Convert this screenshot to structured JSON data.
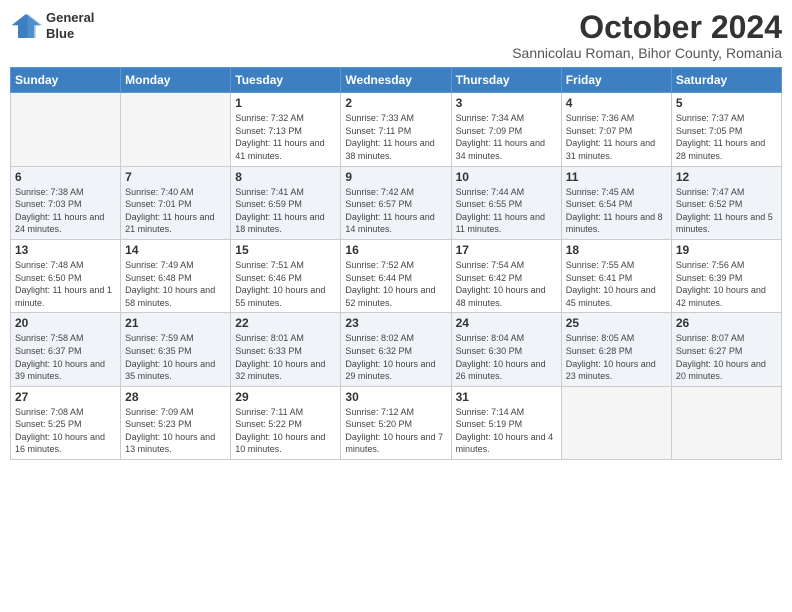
{
  "logo": {
    "line1": "General",
    "line2": "Blue"
  },
  "title": "October 2024",
  "subtitle": "Sannicolau Roman, Bihor County, Romania",
  "weekdays": [
    "Sunday",
    "Monday",
    "Tuesday",
    "Wednesday",
    "Thursday",
    "Friday",
    "Saturday"
  ],
  "weeks": [
    [
      {
        "day": "",
        "info": ""
      },
      {
        "day": "",
        "info": ""
      },
      {
        "day": "1",
        "info": "Sunrise: 7:32 AM\nSunset: 7:13 PM\nDaylight: 11 hours and 41 minutes."
      },
      {
        "day": "2",
        "info": "Sunrise: 7:33 AM\nSunset: 7:11 PM\nDaylight: 11 hours and 38 minutes."
      },
      {
        "day": "3",
        "info": "Sunrise: 7:34 AM\nSunset: 7:09 PM\nDaylight: 11 hours and 34 minutes."
      },
      {
        "day": "4",
        "info": "Sunrise: 7:36 AM\nSunset: 7:07 PM\nDaylight: 11 hours and 31 minutes."
      },
      {
        "day": "5",
        "info": "Sunrise: 7:37 AM\nSunset: 7:05 PM\nDaylight: 11 hours and 28 minutes."
      }
    ],
    [
      {
        "day": "6",
        "info": "Sunrise: 7:38 AM\nSunset: 7:03 PM\nDaylight: 11 hours and 24 minutes."
      },
      {
        "day": "7",
        "info": "Sunrise: 7:40 AM\nSunset: 7:01 PM\nDaylight: 11 hours and 21 minutes."
      },
      {
        "day": "8",
        "info": "Sunrise: 7:41 AM\nSunset: 6:59 PM\nDaylight: 11 hours and 18 minutes."
      },
      {
        "day": "9",
        "info": "Sunrise: 7:42 AM\nSunset: 6:57 PM\nDaylight: 11 hours and 14 minutes."
      },
      {
        "day": "10",
        "info": "Sunrise: 7:44 AM\nSunset: 6:55 PM\nDaylight: 11 hours and 11 minutes."
      },
      {
        "day": "11",
        "info": "Sunrise: 7:45 AM\nSunset: 6:54 PM\nDaylight: 11 hours and 8 minutes."
      },
      {
        "day": "12",
        "info": "Sunrise: 7:47 AM\nSunset: 6:52 PM\nDaylight: 11 hours and 5 minutes."
      }
    ],
    [
      {
        "day": "13",
        "info": "Sunrise: 7:48 AM\nSunset: 6:50 PM\nDaylight: 11 hours and 1 minute."
      },
      {
        "day": "14",
        "info": "Sunrise: 7:49 AM\nSunset: 6:48 PM\nDaylight: 10 hours and 58 minutes."
      },
      {
        "day": "15",
        "info": "Sunrise: 7:51 AM\nSunset: 6:46 PM\nDaylight: 10 hours and 55 minutes."
      },
      {
        "day": "16",
        "info": "Sunrise: 7:52 AM\nSunset: 6:44 PM\nDaylight: 10 hours and 52 minutes."
      },
      {
        "day": "17",
        "info": "Sunrise: 7:54 AM\nSunset: 6:42 PM\nDaylight: 10 hours and 48 minutes."
      },
      {
        "day": "18",
        "info": "Sunrise: 7:55 AM\nSunset: 6:41 PM\nDaylight: 10 hours and 45 minutes."
      },
      {
        "day": "19",
        "info": "Sunrise: 7:56 AM\nSunset: 6:39 PM\nDaylight: 10 hours and 42 minutes."
      }
    ],
    [
      {
        "day": "20",
        "info": "Sunrise: 7:58 AM\nSunset: 6:37 PM\nDaylight: 10 hours and 39 minutes."
      },
      {
        "day": "21",
        "info": "Sunrise: 7:59 AM\nSunset: 6:35 PM\nDaylight: 10 hours and 35 minutes."
      },
      {
        "day": "22",
        "info": "Sunrise: 8:01 AM\nSunset: 6:33 PM\nDaylight: 10 hours and 32 minutes."
      },
      {
        "day": "23",
        "info": "Sunrise: 8:02 AM\nSunset: 6:32 PM\nDaylight: 10 hours and 29 minutes."
      },
      {
        "day": "24",
        "info": "Sunrise: 8:04 AM\nSunset: 6:30 PM\nDaylight: 10 hours and 26 minutes."
      },
      {
        "day": "25",
        "info": "Sunrise: 8:05 AM\nSunset: 6:28 PM\nDaylight: 10 hours and 23 minutes."
      },
      {
        "day": "26",
        "info": "Sunrise: 8:07 AM\nSunset: 6:27 PM\nDaylight: 10 hours and 20 minutes."
      }
    ],
    [
      {
        "day": "27",
        "info": "Sunrise: 7:08 AM\nSunset: 5:25 PM\nDaylight: 10 hours and 16 minutes."
      },
      {
        "day": "28",
        "info": "Sunrise: 7:09 AM\nSunset: 5:23 PM\nDaylight: 10 hours and 13 minutes."
      },
      {
        "day": "29",
        "info": "Sunrise: 7:11 AM\nSunset: 5:22 PM\nDaylight: 10 hours and 10 minutes."
      },
      {
        "day": "30",
        "info": "Sunrise: 7:12 AM\nSunset: 5:20 PM\nDaylight: 10 hours and 7 minutes."
      },
      {
        "day": "31",
        "info": "Sunrise: 7:14 AM\nSunset: 5:19 PM\nDaylight: 10 hours and 4 minutes."
      },
      {
        "day": "",
        "info": ""
      },
      {
        "day": "",
        "info": ""
      }
    ]
  ]
}
